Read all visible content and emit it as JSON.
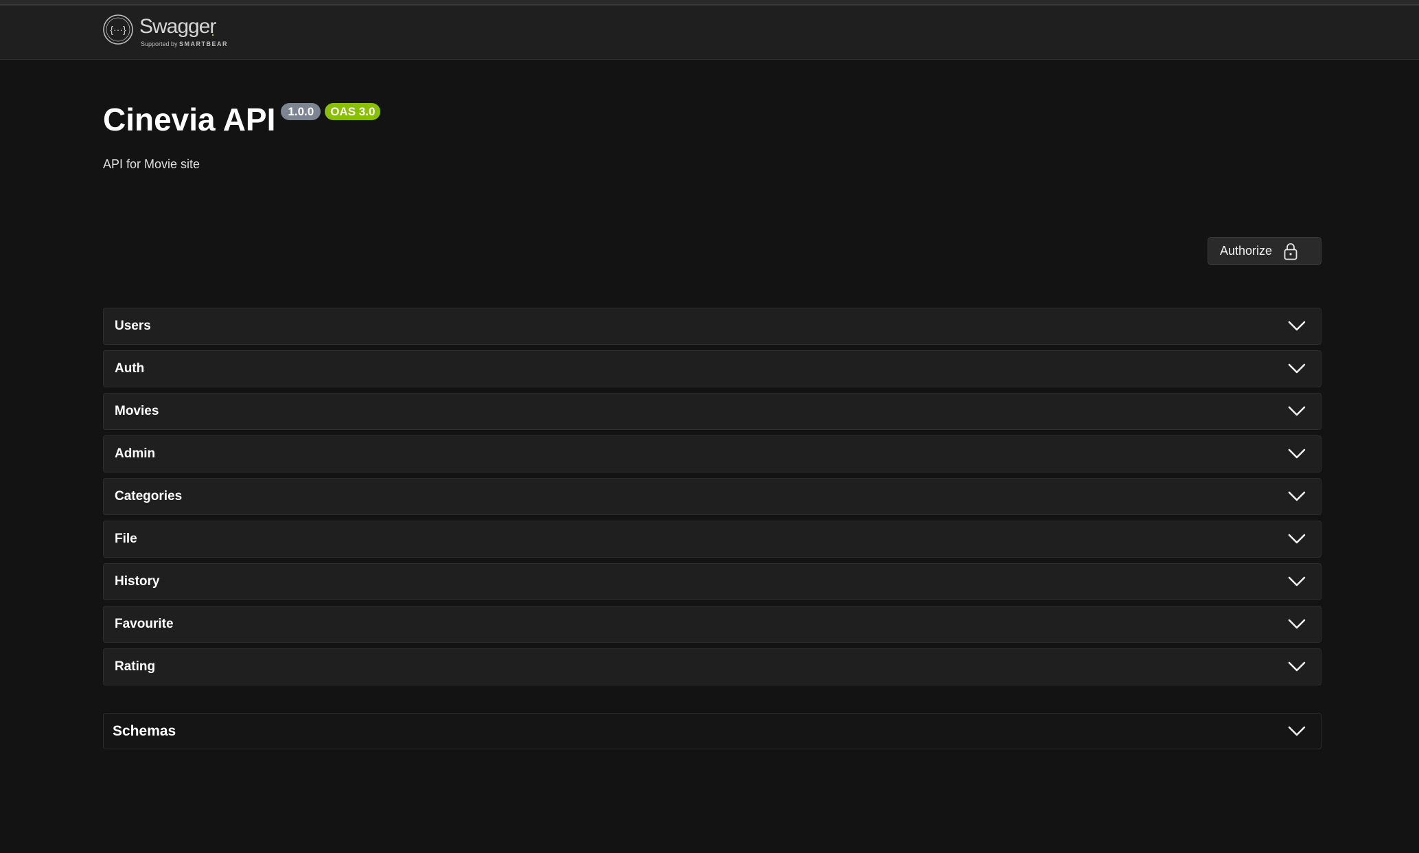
{
  "header": {
    "logo_word": "Swagger",
    "logo_sub_prefix": "Supported by ",
    "logo_sub_brand": "SMARTBEAR"
  },
  "info": {
    "title": "Cinevia API",
    "version": "1.0.0",
    "oas": "OAS 3.0",
    "description": "API for Movie site"
  },
  "authorize": {
    "label": "Authorize"
  },
  "tags": [
    {
      "label": "Users"
    },
    {
      "label": "Auth"
    },
    {
      "label": "Movies"
    },
    {
      "label": "Admin"
    },
    {
      "label": "Categories"
    },
    {
      "label": "File"
    },
    {
      "label": "History"
    },
    {
      "label": "Favourite"
    },
    {
      "label": "Rating"
    }
  ],
  "schemas": {
    "label": "Schemas"
  },
  "colors": {
    "background": "#131313",
    "oas_badge": "#89bf04",
    "version_badge": "#7d8492"
  },
  "icons": {
    "logo": "swagger-logo-icon",
    "lock": "lock-icon",
    "expand": "chevron-down-icon"
  }
}
